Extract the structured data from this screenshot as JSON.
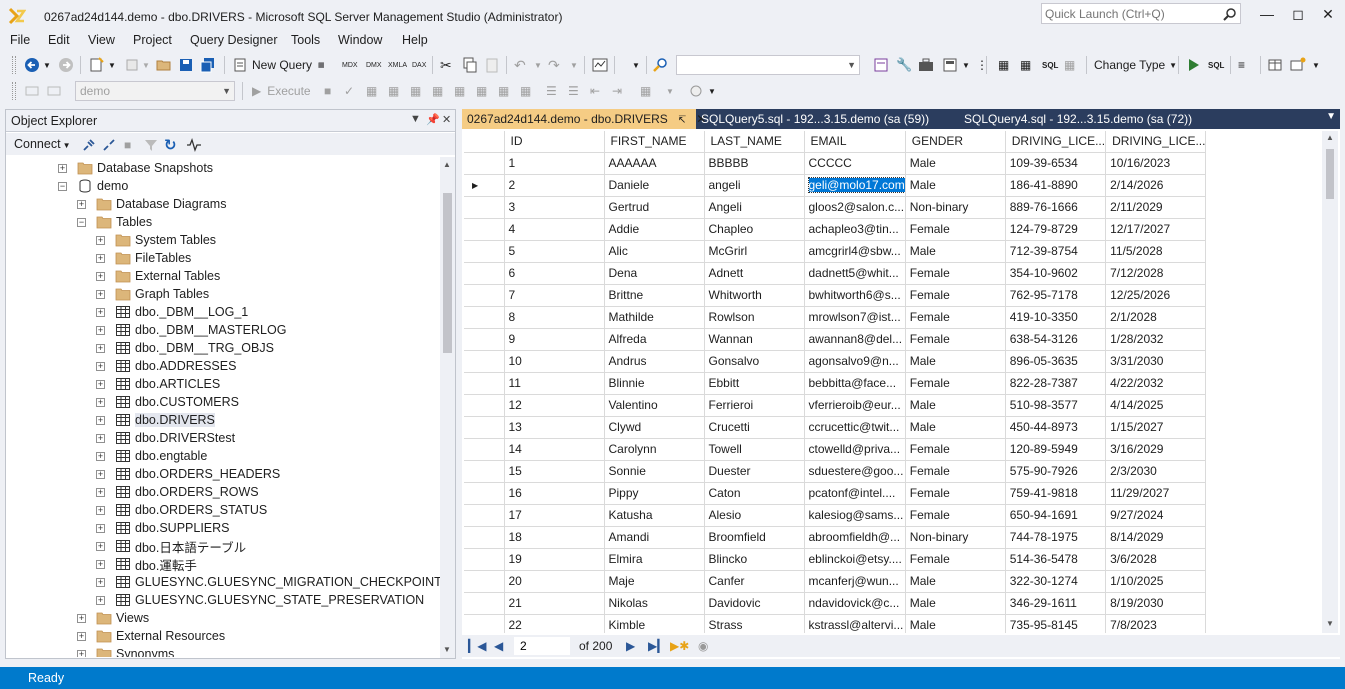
{
  "window": {
    "title": "0267ad24d144.demo - dbo.DRIVERS - Microsoft SQL Server Management Studio (Administrator)",
    "quick_launch_placeholder": "Quick Launch (Ctrl+Q)"
  },
  "menu": [
    "File",
    "Edit",
    "View",
    "Project",
    "Query Designer",
    "Tools",
    "Window",
    "Help"
  ],
  "toolbar": {
    "new_query": "New Query",
    "change_type": "Change Type",
    "database_combo": "demo",
    "execute": "Execute",
    "mdx": "MDX",
    "dmx": "DMX",
    "xmla": "XMLA",
    "dax": "DAX",
    "sql": "SQL"
  },
  "object_explorer": {
    "title": "Object Explorer",
    "connect": "Connect",
    "nodes": [
      {
        "label": "Database Snapshots",
        "level": 0,
        "icon": "folder-icon",
        "exp": "+"
      },
      {
        "label": "demo",
        "level": 0,
        "icon": "database-icon",
        "exp": "-"
      },
      {
        "label": "Database Diagrams",
        "level": 1,
        "icon": "folder-icon",
        "exp": "+"
      },
      {
        "label": "Tables",
        "level": 1,
        "icon": "folder-icon",
        "exp": "-"
      },
      {
        "label": "System Tables",
        "level": 2,
        "icon": "folder-icon",
        "exp": "+"
      },
      {
        "label": "FileTables",
        "level": 2,
        "icon": "folder-icon",
        "exp": "+"
      },
      {
        "label": "External Tables",
        "level": 2,
        "icon": "folder-icon",
        "exp": "+"
      },
      {
        "label": "Graph Tables",
        "level": 2,
        "icon": "folder-icon",
        "exp": "+"
      },
      {
        "label": "dbo._DBM__LOG_1",
        "level": 2,
        "icon": "table-icon",
        "exp": "+"
      },
      {
        "label": "dbo._DBM__MASTERLOG",
        "level": 2,
        "icon": "table-icon",
        "exp": "+"
      },
      {
        "label": "dbo._DBM__TRG_OBJS",
        "level": 2,
        "icon": "table-icon",
        "exp": "+"
      },
      {
        "label": "dbo.ADDRESSES",
        "level": 2,
        "icon": "table-icon",
        "exp": "+"
      },
      {
        "label": "dbo.ARTICLES",
        "level": 2,
        "icon": "table-icon",
        "exp": "+"
      },
      {
        "label": "dbo.CUSTOMERS",
        "level": 2,
        "icon": "table-icon",
        "exp": "+"
      },
      {
        "label": "dbo.DRIVERS",
        "level": 2,
        "icon": "table-icon",
        "exp": "+",
        "selected": true
      },
      {
        "label": "dbo.DRIVERStest",
        "level": 2,
        "icon": "table-icon",
        "exp": "+"
      },
      {
        "label": "dbo.engtable",
        "level": 2,
        "icon": "table-icon",
        "exp": "+"
      },
      {
        "label": "dbo.ORDERS_HEADERS",
        "level": 2,
        "icon": "table-icon",
        "exp": "+"
      },
      {
        "label": "dbo.ORDERS_ROWS",
        "level": 2,
        "icon": "table-icon",
        "exp": "+"
      },
      {
        "label": "dbo.ORDERS_STATUS",
        "level": 2,
        "icon": "table-icon",
        "exp": "+"
      },
      {
        "label": "dbo.SUPPLIERS",
        "level": 2,
        "icon": "table-icon",
        "exp": "+"
      },
      {
        "label": "dbo.日本語テーブル",
        "level": 2,
        "icon": "table-icon",
        "exp": "+"
      },
      {
        "label": "dbo.運転手",
        "level": 2,
        "icon": "table-icon",
        "exp": "+"
      },
      {
        "label": "GLUESYNC.GLUESYNC_MIGRATION_CHECKPOINT",
        "level": 2,
        "icon": "table-icon",
        "exp": "+"
      },
      {
        "label": "GLUESYNC.GLUESYNC_STATE_PRESERVATION",
        "level": 2,
        "icon": "table-icon",
        "exp": "+"
      },
      {
        "label": "Views",
        "level": 1,
        "icon": "folder-icon",
        "exp": "+"
      },
      {
        "label": "External Resources",
        "level": 1,
        "icon": "folder-icon",
        "exp": "+"
      },
      {
        "label": "Synonyms",
        "level": 1,
        "icon": "folder-icon",
        "exp": "+"
      }
    ]
  },
  "tabs": [
    {
      "label": "0267ad24d144.demo - dbo.DRIVERS",
      "active": true
    },
    {
      "label": "SQLQuery5.sql - 192...3.15.demo (sa (59))",
      "active": false
    },
    {
      "label": "SQLQuery4.sql - 192...3.15.demo (sa (72))",
      "active": false
    }
  ],
  "grid": {
    "columns": [
      "ID",
      "FIRST_NAME",
      "LAST_NAME",
      "EMAIL",
      "GENDER",
      "DRIVING_LICE...",
      "DRIVING_LICE..."
    ],
    "current_row_marker": "▶",
    "rows": [
      [
        "1",
        "AAAAAA",
        "BBBBB",
        "CCCCC",
        "Male",
        "109-39-6534",
        "10/16/2023"
      ],
      [
        "2",
        "Daniele",
        "angeli",
        "geli@molo17.com",
        "Male",
        "186-41-8890",
        "2/14/2026"
      ],
      [
        "3",
        "Gertrud",
        "Angeli",
        "gloos2@salon.c...",
        "Non-binary",
        "889-76-1666",
        "2/11/2029"
      ],
      [
        "4",
        "Addie",
        "Chapleo",
        "achapleo3@tin...",
        "Female",
        "124-79-8729",
        "12/17/2027"
      ],
      [
        "5",
        "Alic",
        "McGrirl",
        "amcgrirl4@sbw...",
        "Male",
        "712-39-8754",
        "11/5/2028"
      ],
      [
        "6",
        "Dena",
        "Adnett",
        "dadnett5@whit...",
        "Female",
        "354-10-9602",
        "7/12/2028"
      ],
      [
        "7",
        "Brittne",
        "Whitworth",
        "bwhitworth6@s...",
        "Female",
        "762-95-7178",
        "12/25/2026"
      ],
      [
        "8",
        "Mathilde",
        "Rowlson",
        "mrowlson7@ist...",
        "Female",
        "419-10-3350",
        "2/1/2028"
      ],
      [
        "9",
        "Alfreda",
        "Wannan",
        "awannan8@del...",
        "Female",
        "638-54-3126",
        "1/28/2032"
      ],
      [
        "10",
        "Andrus",
        "Gonsalvo",
        "agonsalvo9@n...",
        "Male",
        "896-05-3635",
        "3/31/2030"
      ],
      [
        "11",
        "Blinnie",
        "Ebbitt",
        "bebbitta@face...",
        "Female",
        "822-28-7387",
        "4/22/2032"
      ],
      [
        "12",
        "Valentino",
        "Ferrieroi",
        "vferrieroib@eur...",
        "Male",
        "510-98-3577",
        "4/14/2025"
      ],
      [
        "13",
        "Clywd",
        "Crucetti",
        "ccrucettic@twit...",
        "Male",
        "450-44-8973",
        "1/15/2027"
      ],
      [
        "14",
        "Carolynn",
        "Towell",
        "ctowelld@priva...",
        "Female",
        "120-89-5949",
        "3/16/2029"
      ],
      [
        "15",
        "Sonnie",
        "Duester",
        "sduestere@goo...",
        "Female",
        "575-90-7926",
        "2/3/2030"
      ],
      [
        "16",
        "Pippy",
        "Caton",
        "pcatonf@intel....",
        "Female",
        "759-41-9818",
        "11/29/2027"
      ],
      [
        "17",
        "Katusha",
        "Alesio",
        "kalesiog@sams...",
        "Female",
        "650-94-1691",
        "9/27/2024"
      ],
      [
        "18",
        "Amandi",
        "Broomfield",
        "abroomfieldh@...",
        "Non-binary",
        "744-78-1975",
        "8/14/2029"
      ],
      [
        "19",
        "Elmira",
        "Blincko",
        "eblinckoi@etsy....",
        "Female",
        "514-36-5478",
        "3/6/2028"
      ],
      [
        "20",
        "Maje",
        "Canfer",
        "mcanferj@wun...",
        "Male",
        "322-30-1274",
        "1/10/2025"
      ],
      [
        "21",
        "Nikolas",
        "Davidovic",
        "ndavidovick@c...",
        "Male",
        "346-29-1611",
        "8/19/2030"
      ],
      [
        "22",
        "Kimble",
        "Strass",
        "kstrassl@altervi...",
        "Male",
        "735-95-8145",
        "7/8/2023"
      ]
    ]
  },
  "navigator": {
    "current_record": "2",
    "of_label": "of 200"
  },
  "status": {
    "text": "Ready"
  },
  "colors": {
    "accent": "#007acc",
    "active_tab": "#f5cc84",
    "tab_strip": "#2b3d5e",
    "selection": "#0078d7"
  }
}
